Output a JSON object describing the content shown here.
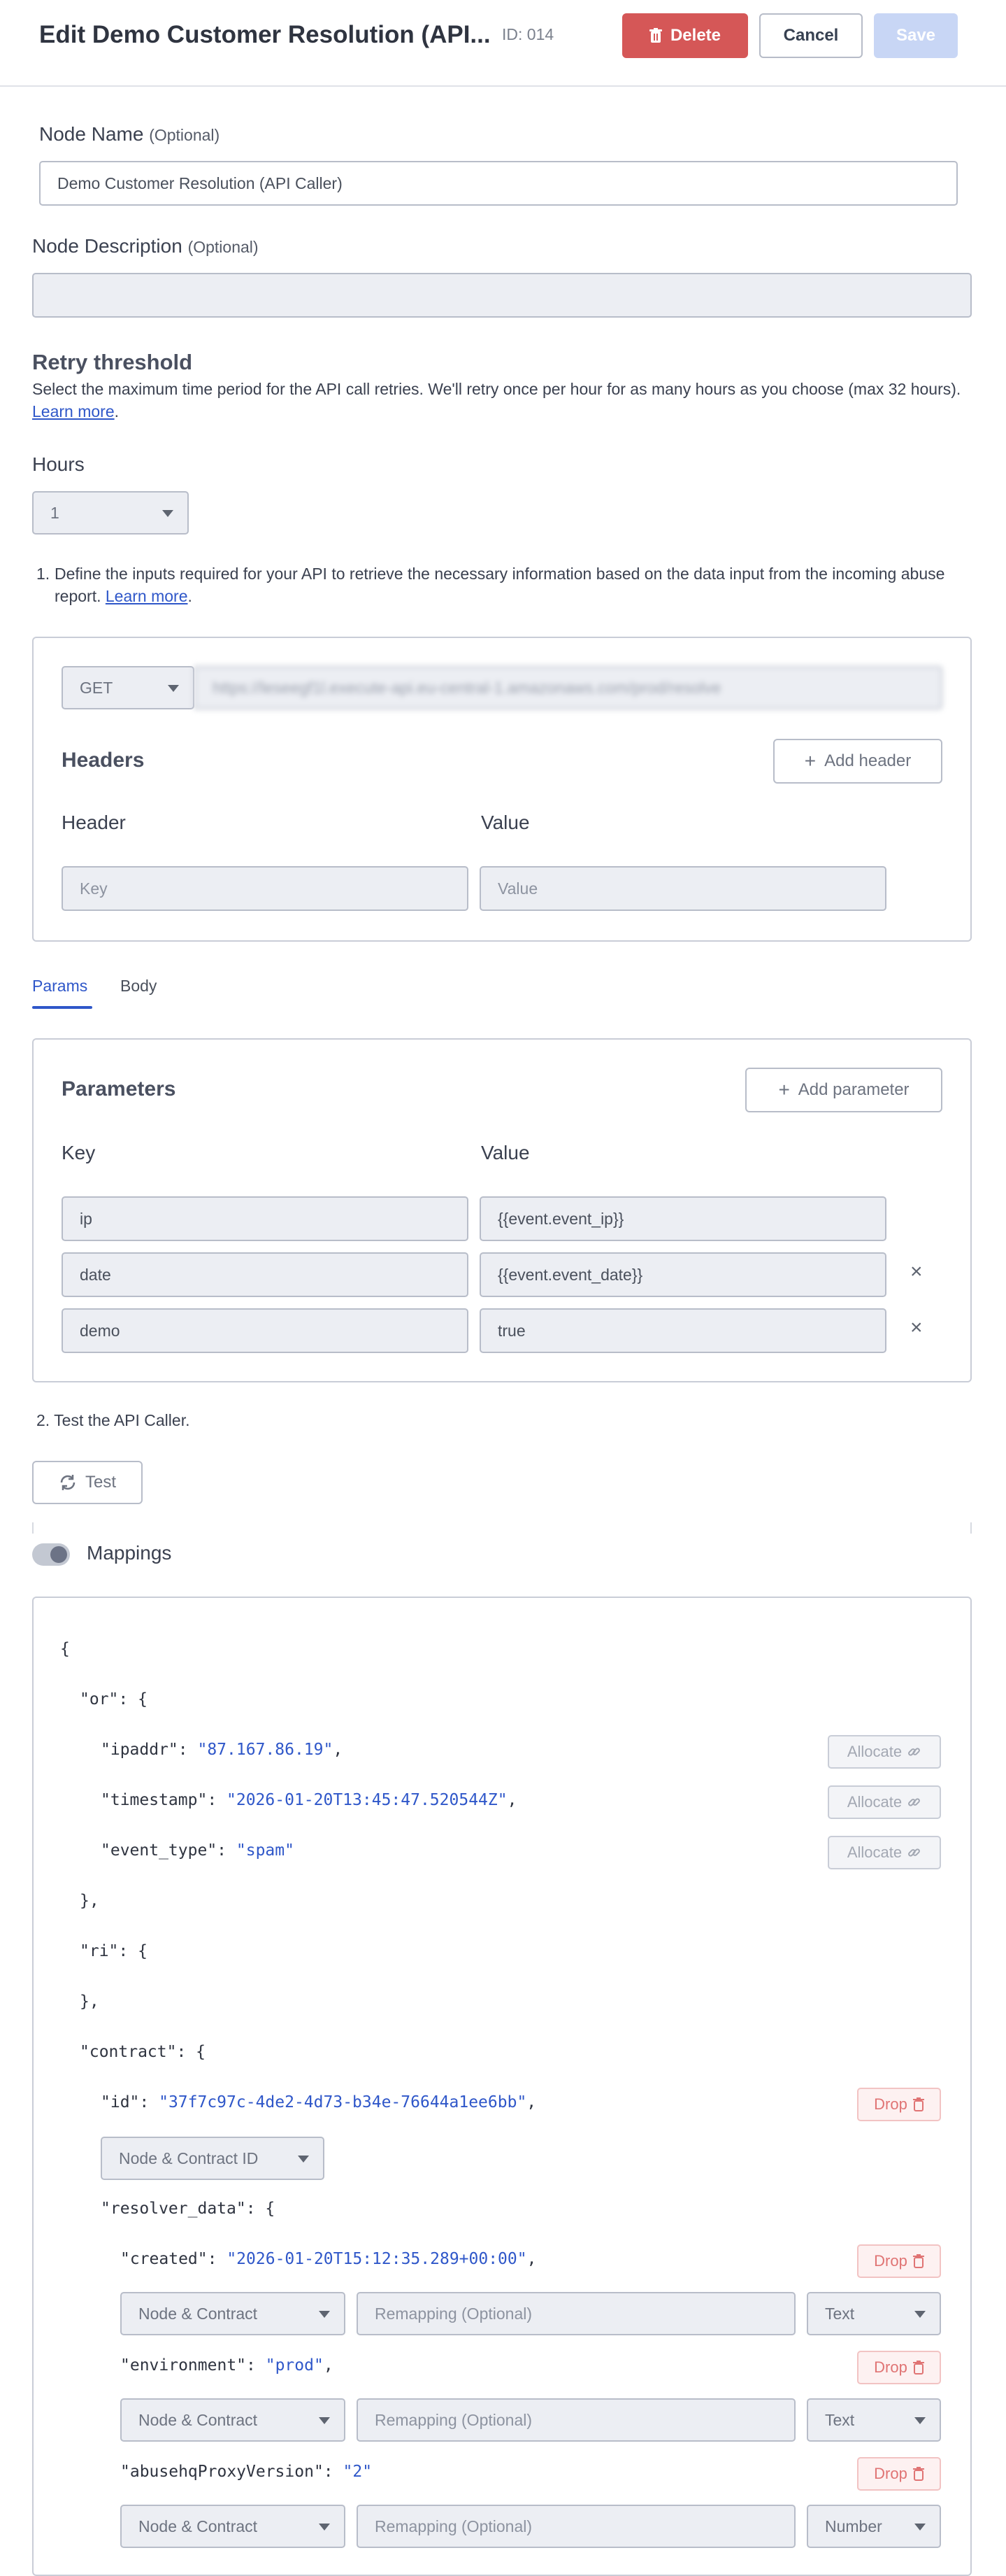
{
  "header": {
    "title": "Edit Demo Customer Resolution (API...",
    "id_label": "ID: 014",
    "delete_label": "Delete",
    "cancel_label": "Cancel",
    "save_label": "Save"
  },
  "node_name": {
    "label": "Node Name",
    "optional": "(Optional)",
    "value": "Demo Customer Resolution (API Caller)"
  },
  "node_description": {
    "label": "Node Description",
    "optional": "(Optional)",
    "value": ""
  },
  "retry": {
    "title": "Retry threshold",
    "help": "Select the maximum time period for the API call retries. We'll retry once per hour for as many hours as you choose (max 32 hours).",
    "learn_more": "Learn more",
    "hours_label": "Hours",
    "hours_value": "1"
  },
  "step1": {
    "prefix": "1.",
    "text": "Define the inputs required for your API to retrieve the necessary information based on the data input from the incoming abuse report.",
    "learn_more": "Learn more"
  },
  "request": {
    "method": "GET",
    "url": "https://leseegf1l.execute-api.eu-central-1.amazonaws.com/prod/resolve",
    "headers_title": "Headers",
    "add_header_label": "Add header",
    "header_col": "Header",
    "value_col": "Value",
    "key_placeholder": "Key",
    "value_placeholder": "Value"
  },
  "tabs": {
    "params": "Params",
    "body": "Body"
  },
  "parameters": {
    "title": "Parameters",
    "add_label": "Add parameter",
    "key_col": "Key",
    "value_col": "Value",
    "rows": [
      {
        "key": "ip",
        "value": "{{event.event_ip}}"
      },
      {
        "key": "date",
        "value": "{{event.event_date}}"
      },
      {
        "key": "demo",
        "value": "true"
      }
    ]
  },
  "step2": {
    "text": "2. Test the API Caller.",
    "test_label": "Test"
  },
  "mappings": {
    "label": "Mappings",
    "allocate_label": "Allocate",
    "drop_label": "Drop",
    "ipaddr": "\"87.167.86.19\"",
    "timestamp": "\"2026-01-20T13:45:47.520544Z\"",
    "event_type": "\"spam\"",
    "contract_id": "\"37f7c97c-4de2-4d73-b34e-76644a1ee6bb\"",
    "contract_select": "Node & Contract ID",
    "created": "\"2026-01-20T15:12:35.289+00:00\"",
    "environment": "\"prod\"",
    "proxy_version": "\"2\"",
    "node_contract": "Node & Contract",
    "remap_placeholder": "Remapping (Optional)",
    "type_text": "Text",
    "type_number": "Number"
  }
}
